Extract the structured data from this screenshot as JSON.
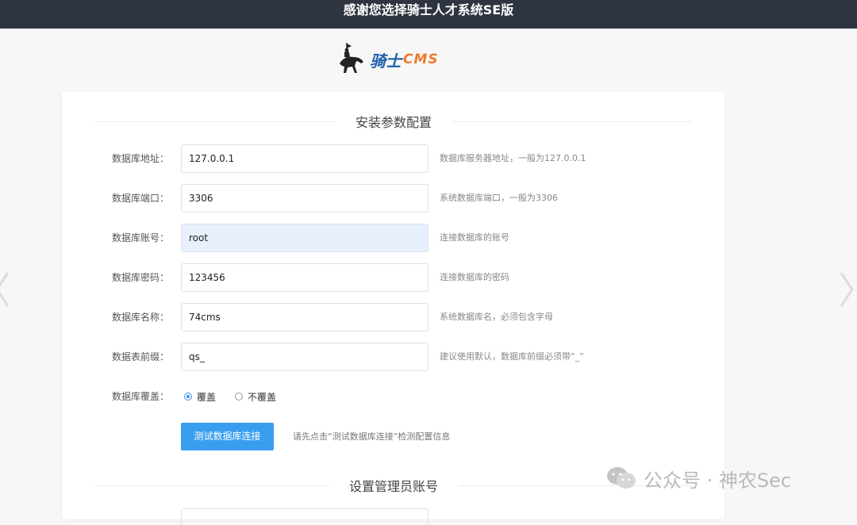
{
  "header": {
    "title": "感谢您选择骑士人才系统SE版"
  },
  "logo": {
    "text_cn": "骑士",
    "text_en": "CMS"
  },
  "section_install": {
    "title": "安装参数配置"
  },
  "fields": [
    {
      "label": "数据库地址：",
      "value": "127.0.0.1",
      "hint": "数据库服务器地址，一般为127.0.0.1"
    },
    {
      "label": "数据库端口：",
      "value": "3306",
      "hint": "系统数据库端口，一般为3306"
    },
    {
      "label": "数据库账号：",
      "value": "root",
      "hint": "连接数据库的账号"
    },
    {
      "label": "数据库密码：",
      "value": "123456",
      "hint": "连接数据库的密码"
    },
    {
      "label": "数据库名称：",
      "value": "74cms",
      "hint": "系统数据库名，必须包含字母"
    },
    {
      "label": "数据表前缀：",
      "value": "qs_",
      "hint": "建议使用默认，数据库前缀必须带“_”"
    }
  ],
  "overwrite": {
    "label": "数据库覆盖：",
    "options": [
      {
        "label": "覆盖",
        "selected": true
      },
      {
        "label": "不覆盖",
        "selected": false
      }
    ]
  },
  "test_button": {
    "label": "测试数据库连接",
    "note": "请先点击“测试数据库连接”检测配置信息"
  },
  "section_admin": {
    "title": "设置管理员账号"
  },
  "watermark": {
    "text": "公众号 · 神农Sec"
  },
  "colors": {
    "accent": "#3a9ef0",
    "topbar": "#2f3441",
    "autofill": "#e8f0fe"
  }
}
